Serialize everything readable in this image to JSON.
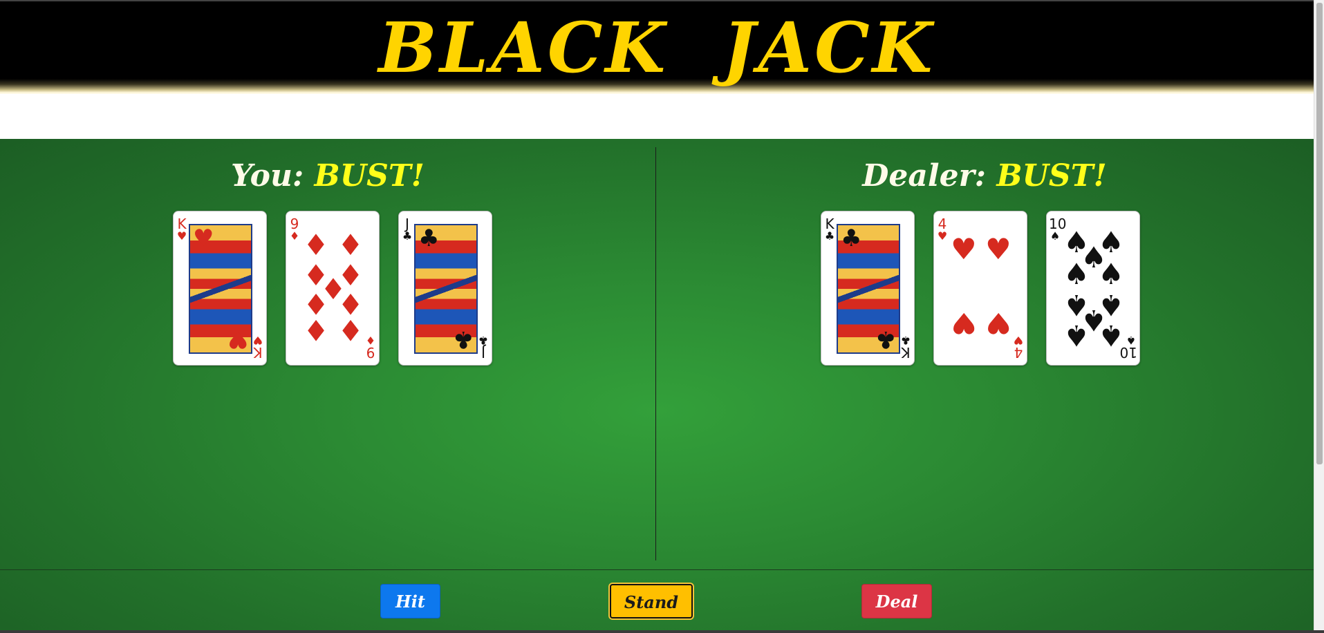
{
  "header": {
    "title": "BLACK  JACK"
  },
  "player": {
    "label": "You:",
    "status": "BUST!",
    "cards": [
      {
        "rank": "K",
        "suit": "♥",
        "color": "red",
        "face": true
      },
      {
        "rank": "9",
        "suit": "♦",
        "color": "red",
        "face": false
      },
      {
        "rank": "J",
        "suit": "♣",
        "color": "black",
        "face": true
      }
    ]
  },
  "dealer": {
    "label": "Dealer:",
    "status": "BUST!",
    "cards": [
      {
        "rank": "K",
        "suit": "♣",
        "color": "black",
        "face": true
      },
      {
        "rank": "4",
        "suit": "♥",
        "color": "red",
        "face": false
      },
      {
        "rank": "10",
        "suit": "♠",
        "color": "black",
        "face": false
      }
    ]
  },
  "controls": {
    "hit_label": "Hit",
    "stand_label": "Stand",
    "deal_label": "Deal"
  },
  "colors": {
    "title": "#ffd400",
    "status": "#ffff1a",
    "table": "#2b8a33",
    "hit": "#0d78ee",
    "stand": "#ffbf00",
    "deal": "#dc3545"
  }
}
